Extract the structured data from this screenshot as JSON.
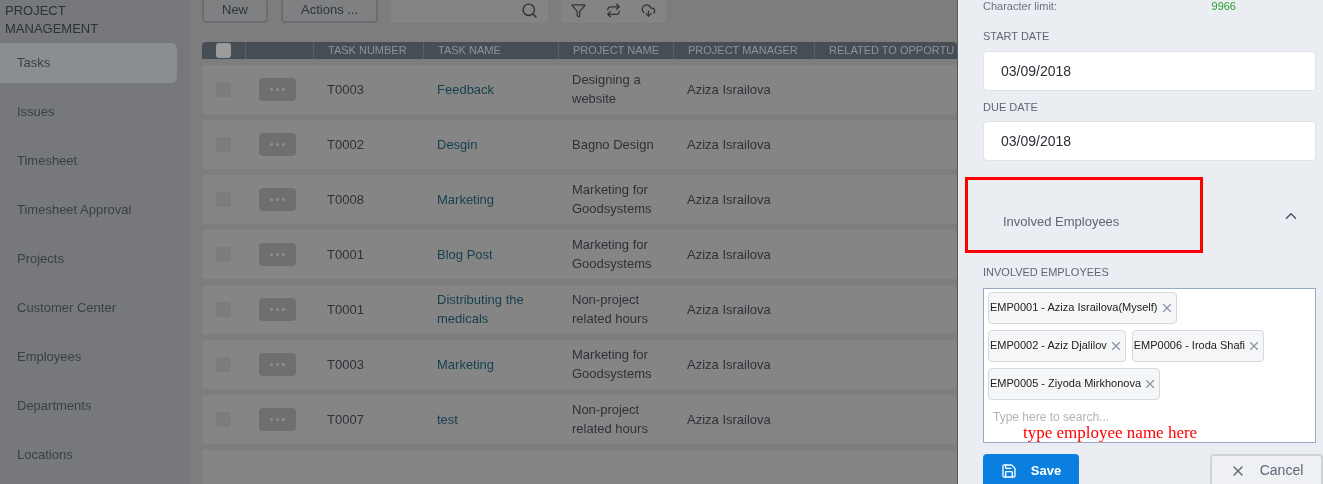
{
  "sidebar": {
    "title": "PROJECT MANAGEMENT",
    "items": [
      {
        "label": "Tasks",
        "selected": true
      },
      {
        "label": "Issues",
        "selected": false
      },
      {
        "label": "Timesheet",
        "selected": false
      },
      {
        "label": "Timesheet Approval",
        "selected": false
      },
      {
        "label": "Projects",
        "selected": false
      },
      {
        "label": "Customer Center",
        "selected": false
      },
      {
        "label": "Employees",
        "selected": false
      },
      {
        "label": "Departments",
        "selected": false
      },
      {
        "label": "Locations",
        "selected": false
      }
    ]
  },
  "toolbar": {
    "buttons": [
      "New",
      "Actions ..."
    ]
  },
  "table": {
    "select_all": {
      "checked": false
    },
    "columns": [
      "TASK NUMBER",
      "TASK NAME",
      "PROJECT NAME",
      "PROJECT MANAGER",
      "RELATED TO OPPORTU"
    ],
    "rows": [
      {
        "checked": false,
        "task_number": "T0003",
        "task_name": "Feedback",
        "project_name": "Designing a website",
        "project_manager": "Aziza Israilova"
      },
      {
        "checked": false,
        "task_number": "T0002",
        "task_name": "Desgin",
        "project_name": "Bagno Design",
        "project_manager": "Aziza Israilova"
      },
      {
        "checked": false,
        "task_number": "T0008",
        "task_name": "Marketing",
        "project_name": "Marketing for Goodsystems",
        "project_manager": "Aziza Israilova"
      },
      {
        "checked": false,
        "task_number": "T0001",
        "task_name": "Blog Post",
        "project_name": "Marketing for Goodsystems",
        "project_manager": "Aziza Israilova"
      },
      {
        "checked": false,
        "task_number": "T0001",
        "task_name": "Distributing the medicals",
        "project_name": "Non-project related hours",
        "project_manager": "Aziza Israilova"
      },
      {
        "checked": false,
        "task_number": "T0003",
        "task_name": "Marketing",
        "project_name": "Marketing for Goodsystems",
        "project_manager": "Aziza Israilova"
      },
      {
        "checked": false,
        "task_number": "T0007",
        "task_name": "test",
        "project_name": "Non-project related hours",
        "project_manager": "Aziza Israilova"
      }
    ]
  },
  "panel": {
    "character_limit": {
      "label": "Character limit:",
      "value": "9966"
    },
    "fields": [
      {
        "label": "START DATE",
        "value": "03/09/2018"
      },
      {
        "label": "DUE DATE",
        "value": "03/09/2018"
      }
    ],
    "section": {
      "title": "Involved Employees",
      "expanded": true
    },
    "employees": {
      "label": "INVOLVED EMPLOYEES",
      "tags": [
        "EMP0001 - Aziza Israilova(Myself)",
        "EMP0002 - Aziz Djalilov",
        "EMP0006 - Iroda Shafi",
        "EMP0005 - Ziyoda Mirkhonova"
      ],
      "placeholder": "Type here to search..."
    },
    "annotation": "type employee name here",
    "buttons": [
      {
        "label": "Save",
        "kind": "primary"
      },
      {
        "label": "Cancel",
        "kind": "secondary"
      }
    ]
  }
}
